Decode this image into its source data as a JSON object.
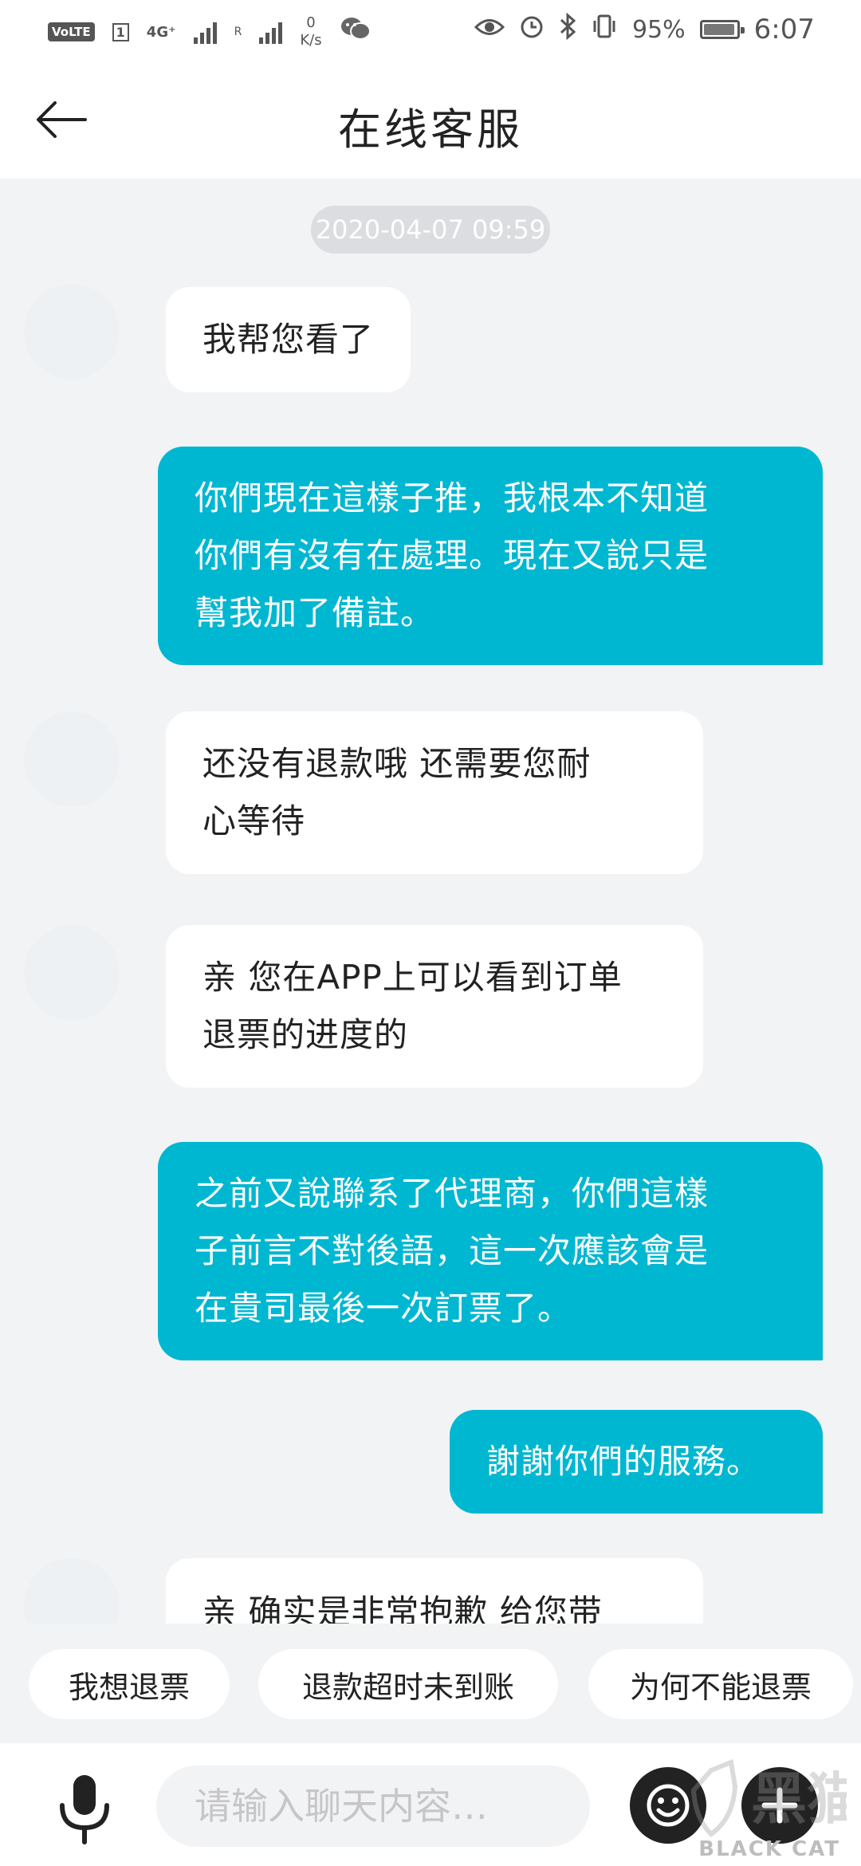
{
  "status_bar": {
    "volte": "VoLTE",
    "sim": "1",
    "network": "4G⁺",
    "roaming": "R",
    "speed_value": "0",
    "speed_unit": "K/s",
    "battery": "95%",
    "battery_level": 0.95,
    "time": "6:07",
    "icons": [
      "wechat-icon",
      "eye-icon",
      "alarm-icon",
      "bluetooth-icon",
      "vibrate-icon",
      "battery-icon"
    ]
  },
  "header": {
    "title": "在线客服",
    "back_icon": "arrow-left-icon"
  },
  "chat": {
    "timestamp": "2020-04-07 09:59",
    "messages": [
      {
        "side": "left",
        "lines": [
          "我帮您看了"
        ]
      },
      {
        "side": "right",
        "lines": [
          "你們現在這樣子推，我根本不知道",
          "你們有沒有在處理。現在又說只是",
          "幫我加了備註。"
        ]
      },
      {
        "side": "left",
        "lines": [
          "还没有退款哦  还需要您耐",
          "心等待"
        ]
      },
      {
        "side": "left",
        "lines": [
          "亲 您在APP上可以看到订单",
          "退票的进度的"
        ]
      },
      {
        "side": "right",
        "lines": [
          "之前又說聯系了代理商，你們這樣",
          "子前言不對後語，這一次應該會是",
          "在貴司最後一次訂票了。"
        ]
      },
      {
        "side": "right",
        "lines": [
          "謝謝你們的服務。"
        ]
      },
      {
        "side": "left",
        "lines": [
          "亲 确实是非常抱歉  给您带"
        ]
      }
    ]
  },
  "quick_replies": [
    "我想退票",
    "退款超时未到账",
    "为何不能退票"
  ],
  "input": {
    "placeholder": "请输入聊天内容…",
    "mic_icon": "microphone-icon",
    "emoji_icon": "emoji-icon",
    "plus_icon": "plus-icon"
  },
  "watermark": "BLACK CAT",
  "colors": {
    "accent": "#00b7d1",
    "background": "#f2f3f5",
    "bubble_left": "#ffffff"
  }
}
